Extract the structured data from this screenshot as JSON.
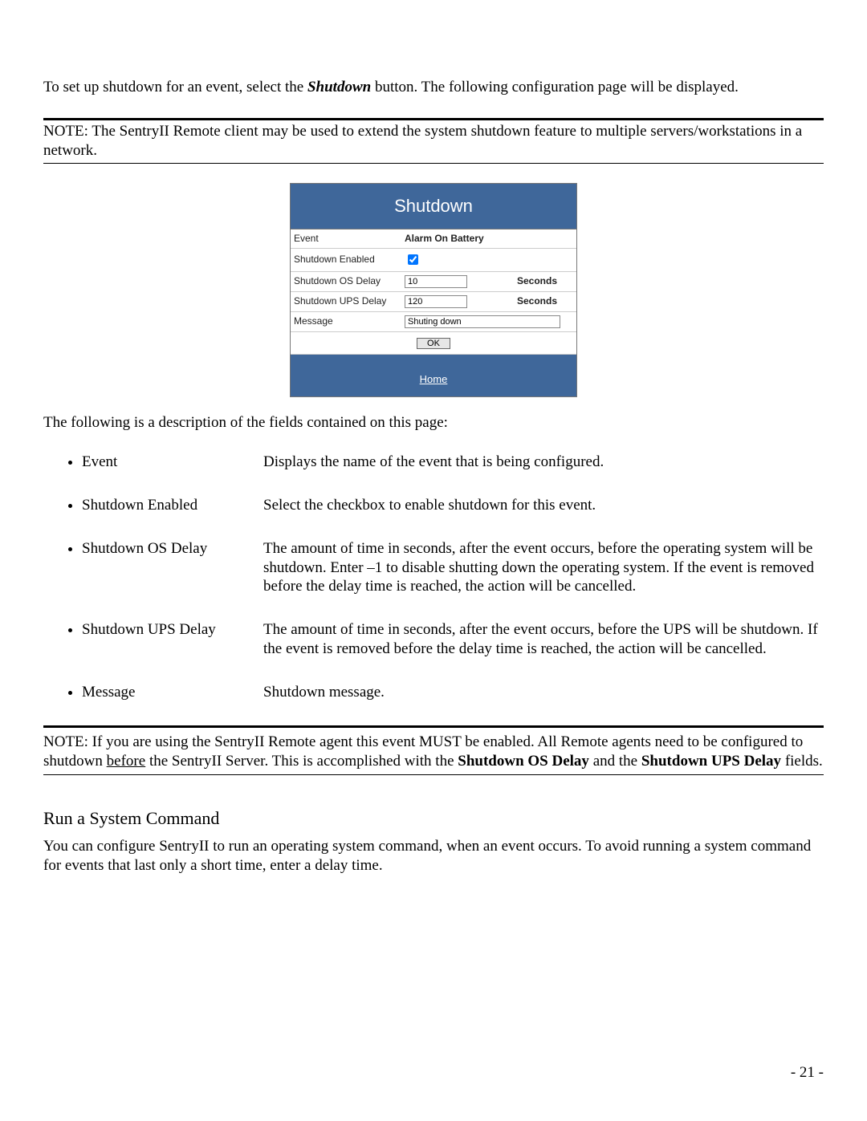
{
  "intro": {
    "pre": "To set up shutdown for an event, select the ",
    "bold": "Shutdown",
    "post": " button. The following configuration page will be displayed."
  },
  "note1": "NOTE: The SentryII Remote client may be used to extend the system shutdown feature to multiple servers/workstations in a network.",
  "panel": {
    "title": "Shutdown",
    "rows": {
      "event_label": "Event",
      "event_value": "Alarm On Battery",
      "enabled_label": "Shutdown Enabled",
      "enabled_checked": true,
      "osdelay_label": "Shutdown OS Delay",
      "osdelay_value": "10",
      "upsdelay_label": "Shutdown UPS Delay",
      "upsdelay_value": "120",
      "seconds": "Seconds",
      "message_label": "Message",
      "message_value": "Shuting down"
    },
    "ok": "OK",
    "home": "Home"
  },
  "fields_intro": "The following is a description of the fields contained on this page:",
  "fields": [
    {
      "name": "Event",
      "desc": "Displays the name of the event that is being configured."
    },
    {
      "name": "Shutdown Enabled",
      "desc": "Select the checkbox to enable shutdown for this event."
    },
    {
      "name": "Shutdown OS Delay",
      "desc": "The amount of time in seconds, after the event occurs, before the operating system will be shutdown.  Enter –1 to disable shutting down the operating system.  If the event is removed before the delay time is reached, the action will be cancelled."
    },
    {
      "name": "Shutdown UPS Delay",
      "desc": "The amount of time in seconds, after the event occurs, before the UPS will be shutdown.  If the event is removed before the delay time is reached, the action will be cancelled."
    },
    {
      "name": "Message",
      "desc": "Shutdown message."
    }
  ],
  "note2": {
    "seg1": "NOTE: If you are using the SentryII Remote agent this event MUST be enabled. All Remote agents need to be configured to shutdown ",
    "u": "before",
    "seg2": " the SentryII Server. This is accomplished with the ",
    "b1": "Shutdown OS Delay",
    "seg3": " and the ",
    "b2": "Shutdown UPS Delay",
    "seg4": " fields."
  },
  "section": {
    "heading": "Run a System Command",
    "body": "You can configure SentryII to run an operating system command, when an event occurs. To avoid running a system command for events that last only a short time, enter a delay time."
  },
  "pagenum": "- 21 -"
}
